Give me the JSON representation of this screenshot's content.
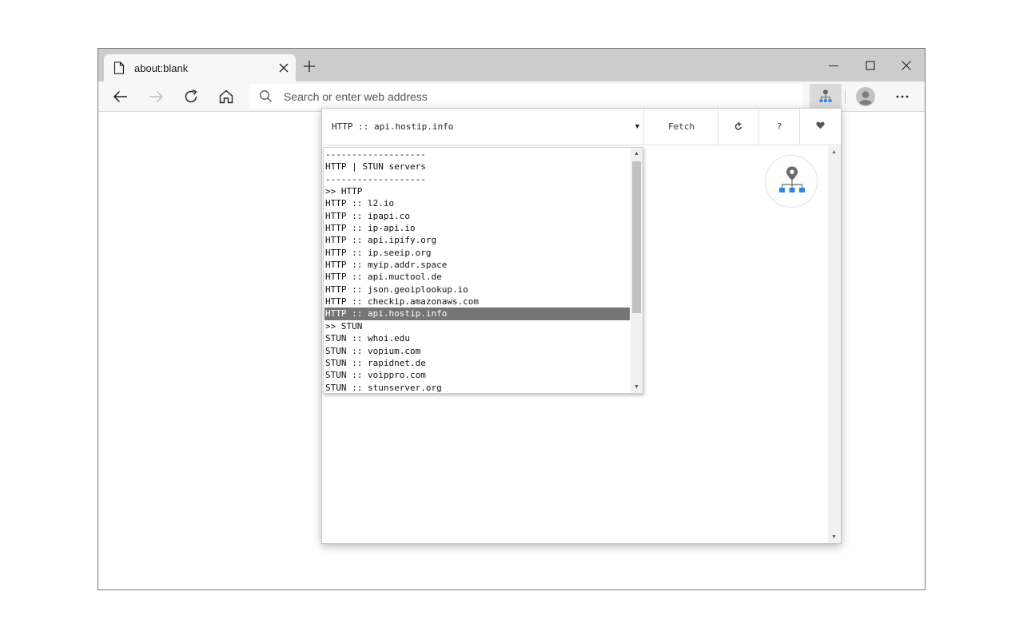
{
  "browser": {
    "tab_title": "about:blank",
    "address_placeholder": "Search or enter web address",
    "icons": [
      "page-icon",
      "close-icon",
      "plus-icon",
      "minimize-icon",
      "maximize-icon",
      "window-close-icon",
      "back-icon",
      "forward-icon",
      "refresh-icon",
      "home-icon",
      "search-icon",
      "extension-icon",
      "profile-icon",
      "more-icon"
    ]
  },
  "popup": {
    "selected_source": "HTTP :: api.hostip.info",
    "fetch_label": "Fetch",
    "help_label": "?",
    "dropdown_items": [
      "-------------------",
      "HTTP | STUN servers",
      "-------------------",
      ">> HTTP",
      "HTTP :: l2.io",
      "HTTP :: ipapi.co",
      "HTTP :: ip-api.io",
      "HTTP :: api.ipify.org",
      "HTTP :: ip.seeip.org",
      "HTTP :: myip.addr.space",
      "HTTP :: api.muctool.de",
      "HTTP :: json.geoiplookup.io",
      "HTTP :: checkip.amazonaws.com",
      "HTTP :: api.hostip.info",
      ">> STUN",
      "STUN :: whoi.edu",
      "STUN :: vopium.com",
      "STUN :: rapidnet.de",
      "STUN :: voippro.com",
      "STUN :: stunserver.org"
    ],
    "selected_index": 13,
    "accent_color": "#2b86e6"
  }
}
